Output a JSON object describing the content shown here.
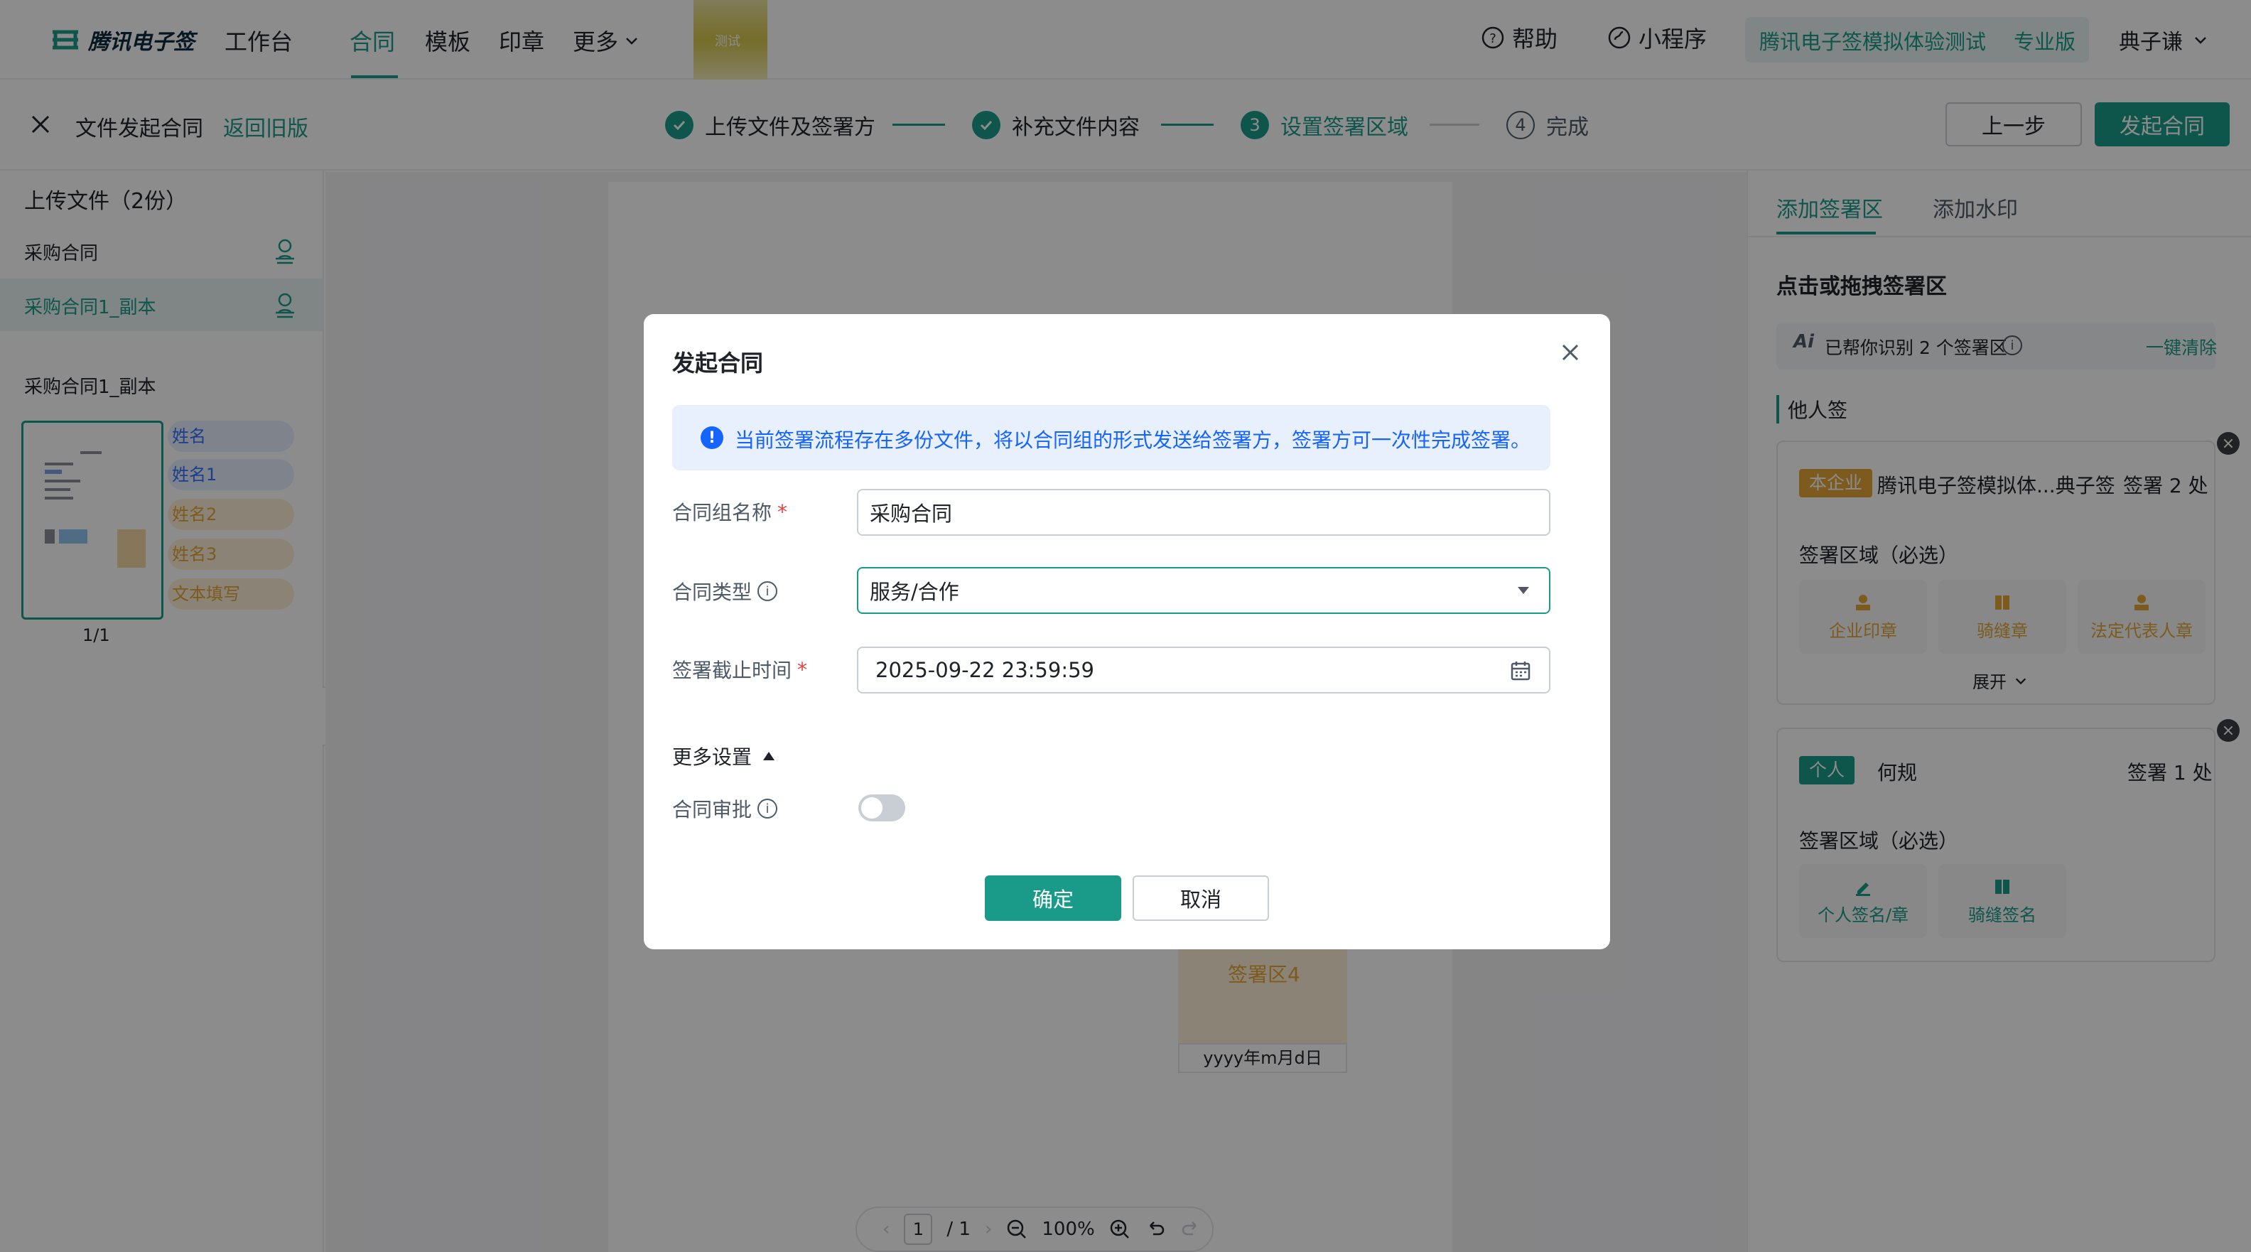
{
  "colors": {
    "accent": "#1a9b8a",
    "info": "#1664ff",
    "danger": "#e83e3e",
    "sign_yellow": "#e3a73a"
  },
  "topnav": {
    "brand": "腾讯电子签",
    "workspace": "工作台",
    "tabs": [
      "合同",
      "模板",
      "印章",
      "更多"
    ],
    "thumb_label": "测试",
    "help": "帮助",
    "mini_program": "小程序",
    "org_name": "腾讯电子签模拟体验测试",
    "org_version": "专业版",
    "user": "典子谦"
  },
  "subheader": {
    "title": "文件发起合同",
    "back_link": "返回旧版",
    "steps": [
      {
        "label": "上传文件及签署方",
        "state": "done"
      },
      {
        "label": "补充文件内容",
        "state": "done"
      },
      {
        "label": "设置签署区域",
        "state": "active",
        "number": "3"
      },
      {
        "label": "完成",
        "state": "todo",
        "number": "4"
      }
    ],
    "prev_button": "上一步",
    "launch_button": "发起合同"
  },
  "left_panel": {
    "header": "上传文件（2份）",
    "files": [
      "采购合同",
      "采购合同1_副本"
    ],
    "selected_file": "采购合同1_副本",
    "field_tags": [
      "姓名",
      "姓名1",
      "姓名2",
      "姓名3",
      "文本填写"
    ],
    "page_count": "1/1"
  },
  "document": {
    "sign_area_label": "签署区4",
    "date_format": "yyyy年m月d日",
    "toolbar": {
      "page": "1",
      "total": "/ 1",
      "zoom": "100%"
    }
  },
  "right_panel": {
    "tabs": [
      "添加签署区",
      "添加水印"
    ],
    "title": "点击或拖拽签署区",
    "ai_text": "已帮你识别 2 个签署区",
    "ai_clear": "一键清除",
    "others_label": "他人签",
    "cards": [
      {
        "badge": "本企业",
        "name": "腾讯电子签模拟体...典子签",
        "count": "签署 2 处",
        "area_label": "签署区域（必选）",
        "tiles": [
          "企业印章",
          "骑缝章",
          "法定代表人章"
        ],
        "expand": "展开"
      },
      {
        "badge": "个人",
        "name": "何规",
        "count": "签署 1 处",
        "area_label": "签署区域（必选）",
        "tiles": [
          "个人签名/章",
          "骑缝签名"
        ]
      }
    ]
  },
  "modal": {
    "title": "发起合同",
    "alert": "当前签署流程存在多份文件，将以合同组的形式发送给签署方，签署方可一次性完成签署。",
    "fields": {
      "group_name_label": "合同组名称",
      "group_name_value": "采购合同",
      "type_label": "合同类型",
      "type_value": "服务/合作",
      "deadline_label": "签署截止时间",
      "deadline_value": "2025-09-22 23:59:59"
    },
    "more_settings": "更多设置",
    "approval_label": "合同审批",
    "approval_enabled": false,
    "ok": "确定",
    "cancel": "取消"
  }
}
